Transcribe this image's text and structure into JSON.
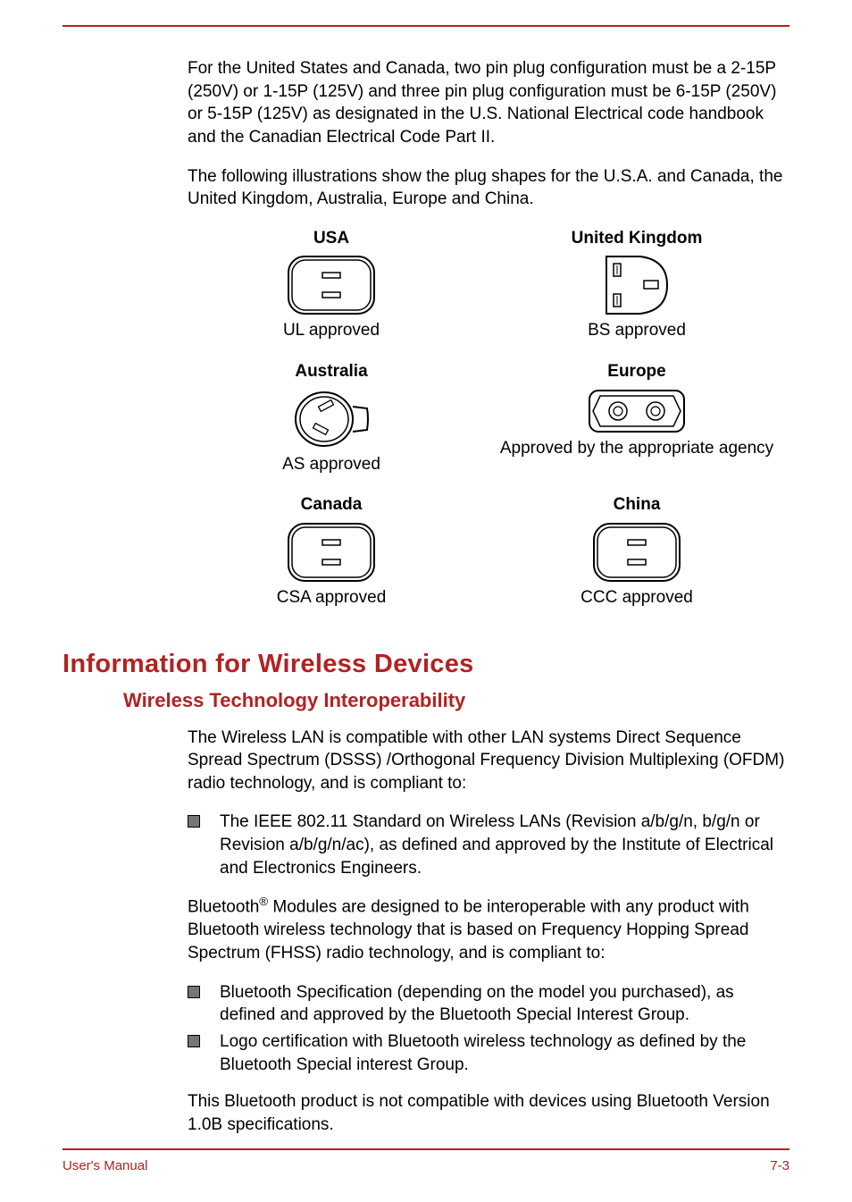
{
  "intro_p1": "For the United States and Canada, two pin plug configuration must be a 2-15P (250V) or 1-15P (125V) and three pin plug configuration must be 6-15P (250V) or 5-15P (125V) as designated in the U.S. National Electrical code handbook and the Canadian Electrical Code Part II.",
  "intro_p2": "The following illustrations show the plug shapes for the U.S.A. and Canada, the United Kingdom, Australia, Europe and China.",
  "plugs": {
    "usa": {
      "heading": "USA",
      "caption": "UL approved"
    },
    "uk": {
      "heading": "United Kingdom",
      "caption": "BS approved"
    },
    "australia": {
      "heading": "Australia",
      "caption": "AS approved"
    },
    "europe": {
      "heading": "Europe",
      "caption": "Approved by the appropriate agency"
    },
    "canada": {
      "heading": "Canada",
      "caption": "CSA approved"
    },
    "china": {
      "heading": "China",
      "caption": "CCC approved"
    }
  },
  "section_h1": "Information for Wireless Devices",
  "section_h2": "Wireless Technology Interoperability",
  "wlan_p": "The Wireless LAN is compatible with other LAN systems Direct Sequence Spread Spectrum (DSSS) /Orthogonal Frequency Division Multiplexing (OFDM) radio technology, and is compliant to:",
  "wlan_li1": "The IEEE 802.11 Standard on Wireless LANs (Revision a/b/g/n, b/g/n or Revision a/b/g/n/ac), as defined and approved by the Institute of Electrical and Electronics Engineers.",
  "bt_p_pre": "Bluetooth",
  "bt_p_sup": "®",
  "bt_p_post": " Modules are designed to be interoperable with any product with Bluetooth wireless technology that is based on Frequency Hopping Spread Spectrum (FHSS) radio technology, and is compliant to:",
  "bt_li1": "Bluetooth Specification (depending on the model you purchased), as defined and approved by the Bluetooth Special Interest Group.",
  "bt_li2": "Logo certification with Bluetooth wireless technology as defined by the Bluetooth Special interest Group.",
  "bt_p2": "This Bluetooth product is not compatible with devices using Bluetooth Version 1.0B specifications.",
  "footer_left": "User's Manual",
  "footer_right": "7-3"
}
